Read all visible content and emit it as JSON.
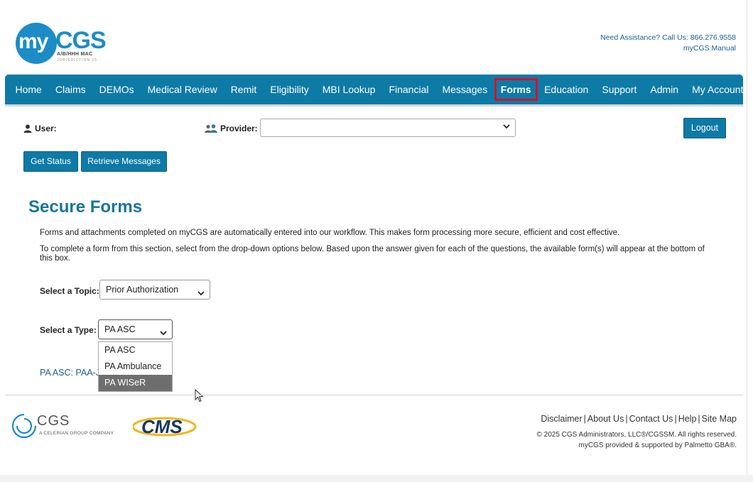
{
  "header": {
    "logo_my": "my",
    "logo_cgs": "CGS",
    "logo_sub": "A/B/HHH MAC",
    "logo_jurisdiction": "JURISDICTION 15",
    "assistance": "Need Assistance? Call Us: 866.276.9558",
    "manual": "myCGS Manual"
  },
  "nav": {
    "items": [
      "Home",
      "Claims",
      "DEMOs",
      "Medical Review",
      "Remit",
      "Eligibility",
      "MBI Lookup",
      "Financial",
      "Messages",
      "Forms",
      "Education",
      "Support",
      "Admin",
      "My Account"
    ],
    "active": "Forms"
  },
  "userbar": {
    "user_label": "User:",
    "provider_label": "Provider:",
    "provider_value": "",
    "logout": "Logout"
  },
  "actions": {
    "get_status": "Get Status",
    "retrieve_messages": "Retrieve Messages"
  },
  "main": {
    "title": "Secure Forms",
    "para1": "Forms and attachments completed on myCGS are automatically entered into our workflow. This makes form processing more secure, efficient and cost effective.",
    "para2": "To complete a form from this section, select from the drop-down options below. Based upon the answer given for each of the questions, the available form(s) will appear at the bottom of this box.",
    "topic_label": "Select a Topic:",
    "topic_value": "Prior Authorization",
    "type_label": "Select a Type:",
    "type_value": "PA ASC",
    "type_options": [
      "PA ASC",
      "PA Ambulance",
      "PA WISeR"
    ],
    "type_highlighted": "PA WISeR",
    "result_link": "PA ASC: PAA-J1"
  },
  "footer": {
    "cgs_name": "CGS",
    "cgs_tagline": "A CELERIAN GROUP COMPANY",
    "cms_name": "CMS",
    "links": [
      "Disclaimer",
      "About Us",
      "Contact Us",
      "Help",
      "Site Map"
    ],
    "copyright": "© 2025 CGS Administrators, LLC®/CGSSM. All rights reserved.",
    "supported": "myCGS provided & supported by Palmetto GBA®."
  },
  "colors": {
    "brand": "#0e7aa6",
    "active_border": "#d0142c",
    "link": "#1a5d9a"
  }
}
